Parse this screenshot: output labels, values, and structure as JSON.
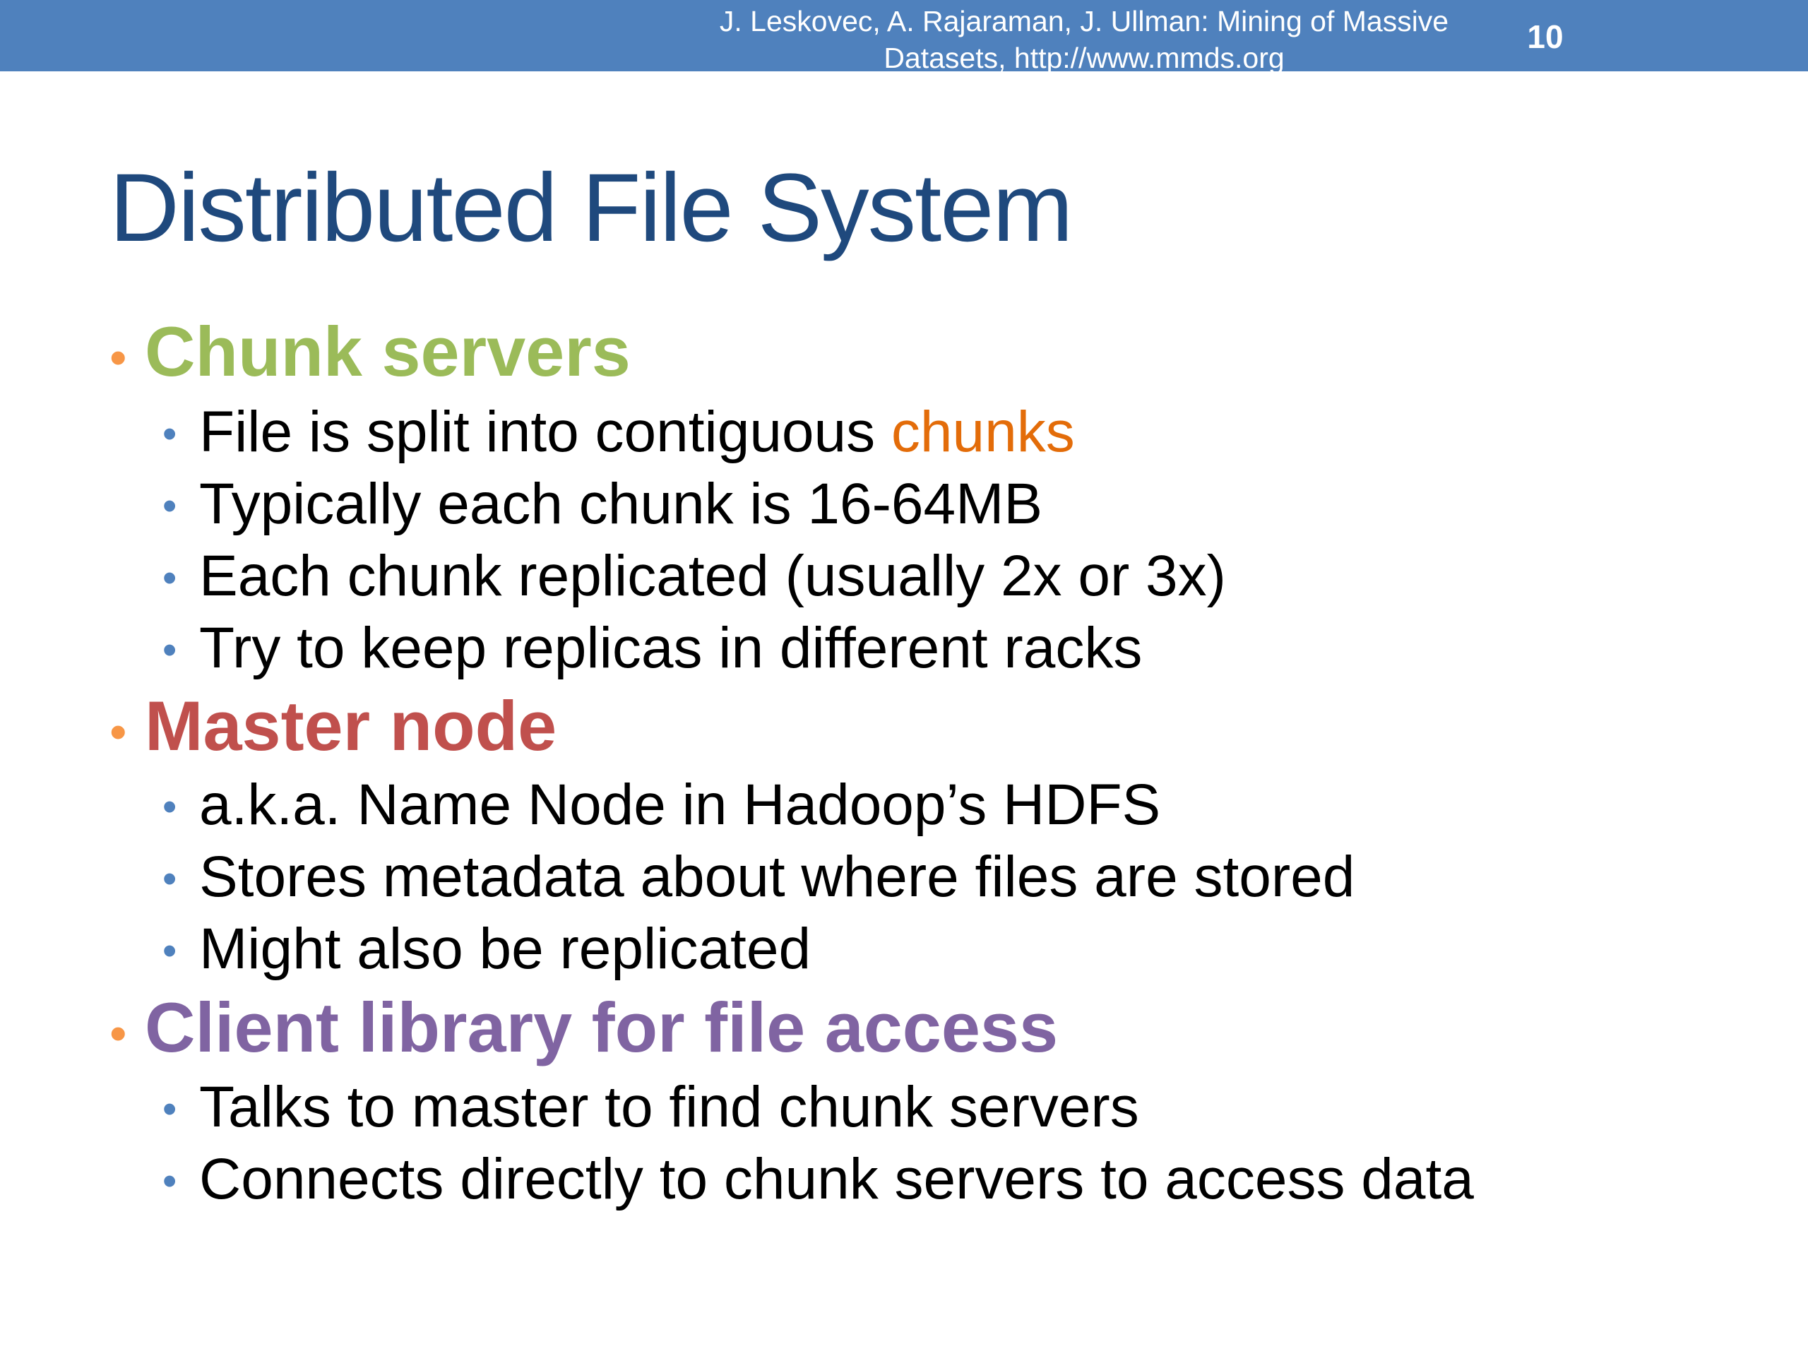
{
  "header": {
    "citation_line1": "J. Leskovec, A. Rajaraman, J. Ullman: Mining of Massive",
    "citation_line2": "Datasets, http://www.mmds.org",
    "page_number": "10"
  },
  "slide": {
    "title": "Distributed File System",
    "bullet_symbol": "•",
    "sections": [
      {
        "heading": "Chunk servers",
        "heading_color": "#9bbb59",
        "items": [
          {
            "text": "File is split into contiguous ",
            "highlight": "chunks"
          },
          {
            "text": "Typically each chunk is 16-64MB"
          },
          {
            "text": "Each chunk replicated (usually 2x or 3x)"
          },
          {
            "text": "Try to keep replicas in different racks"
          }
        ]
      },
      {
        "heading": "Master node",
        "heading_color": "#c0504d",
        "items": [
          {
            "text": "a.k.a. Name Node in Hadoop’s HDFS"
          },
          {
            "text": "Stores metadata about where files are stored"
          },
          {
            "text": "Might also be replicated"
          }
        ]
      },
      {
        "heading": "Client library for file access",
        "heading_color": "#8064a2",
        "items": [
          {
            "text": "Talks to master to find chunk servers"
          },
          {
            "text": "Connects directly to chunk servers to access data"
          }
        ]
      }
    ]
  },
  "colors": {
    "header_bar": "#4f81bd",
    "title": "#1f497d",
    "level1_bullet": "#f79646",
    "level2_bullet": "#4f81bd",
    "highlight": "#e36c09"
  }
}
